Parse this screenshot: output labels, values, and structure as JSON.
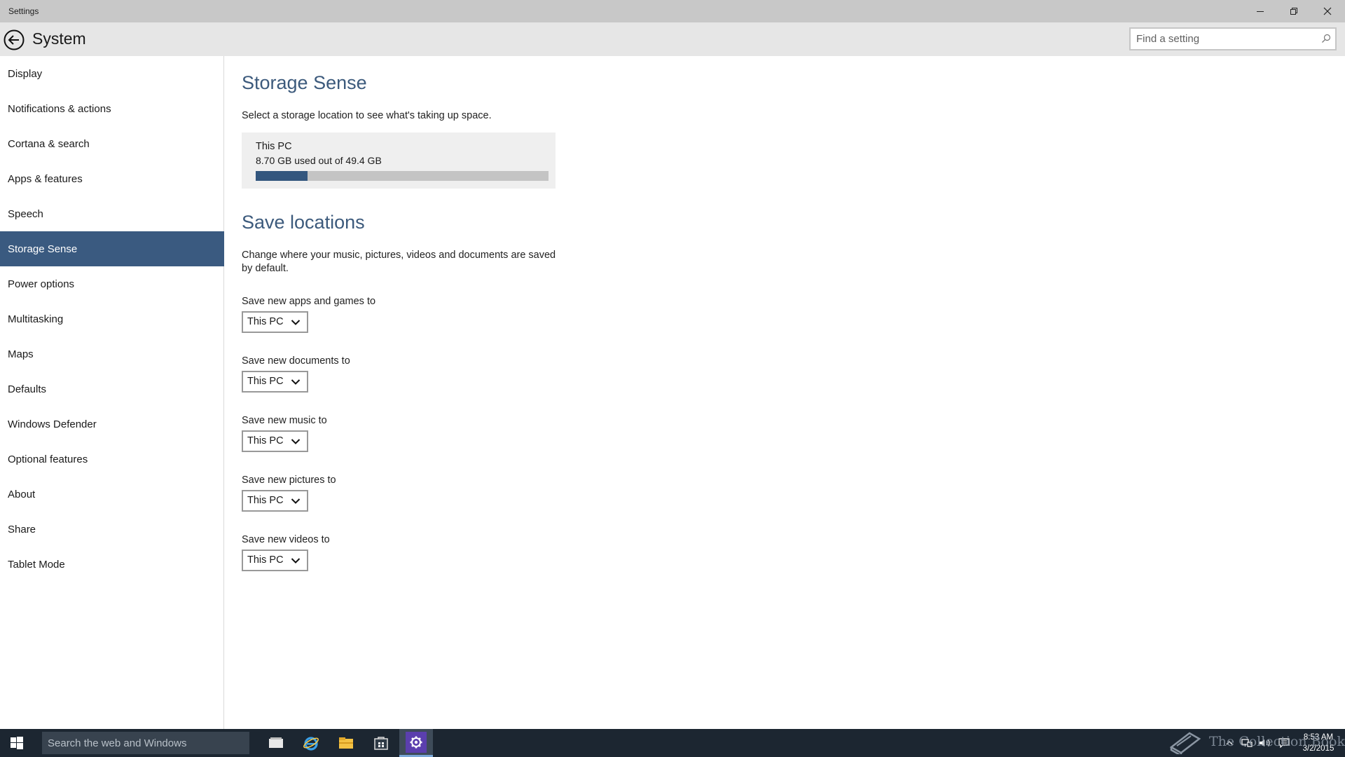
{
  "window": {
    "title": "Settings"
  },
  "header": {
    "page_title": "System",
    "search_placeholder": "Find a setting"
  },
  "sidebar": {
    "items": [
      {
        "label": "Display"
      },
      {
        "label": "Notifications & actions"
      },
      {
        "label": "Cortana & search"
      },
      {
        "label": "Apps & features"
      },
      {
        "label": "Speech"
      },
      {
        "label": "Storage Sense",
        "selected": true
      },
      {
        "label": "Power options"
      },
      {
        "label": "Multitasking"
      },
      {
        "label": "Maps"
      },
      {
        "label": "Defaults"
      },
      {
        "label": "Windows Defender"
      },
      {
        "label": "Optional features"
      },
      {
        "label": "About"
      },
      {
        "label": "Share"
      },
      {
        "label": "Tablet Mode"
      }
    ]
  },
  "main": {
    "storage_heading": "Storage Sense",
    "storage_desc": "Select a storage location to see what's taking up space.",
    "storage": {
      "name": "This PC",
      "usage_text": "8.70 GB used out of 49.4 GB",
      "used_gb": 8.7,
      "total_gb": 49.4
    },
    "save_heading": "Save locations",
    "save_desc": "Change where your music, pictures, videos and documents are saved by default.",
    "save_settings": [
      {
        "label": "Save new apps and games to",
        "value": "This PC"
      },
      {
        "label": "Save new documents to",
        "value": "This PC"
      },
      {
        "label": "Save new music to",
        "value": "This PC"
      },
      {
        "label": "Save new pictures to",
        "value": "This PC"
      },
      {
        "label": "Save new videos to",
        "value": "This PC"
      }
    ]
  },
  "taskbar": {
    "search_placeholder": "Search the web and Windows",
    "apps": [
      "task-view-icon",
      "internet-explorer-icon",
      "file-explorer-icon",
      "store-icon",
      "settings-icon"
    ],
    "clock_time": "8:53 AM",
    "clock_date": "3/2/2015",
    "watermark_text": "The Collection Book"
  },
  "colors": {
    "accent": "#3a5a80",
    "heading": "#3c5a7c",
    "storage_fill": "#33567e",
    "taskbar": "#1c2631"
  }
}
